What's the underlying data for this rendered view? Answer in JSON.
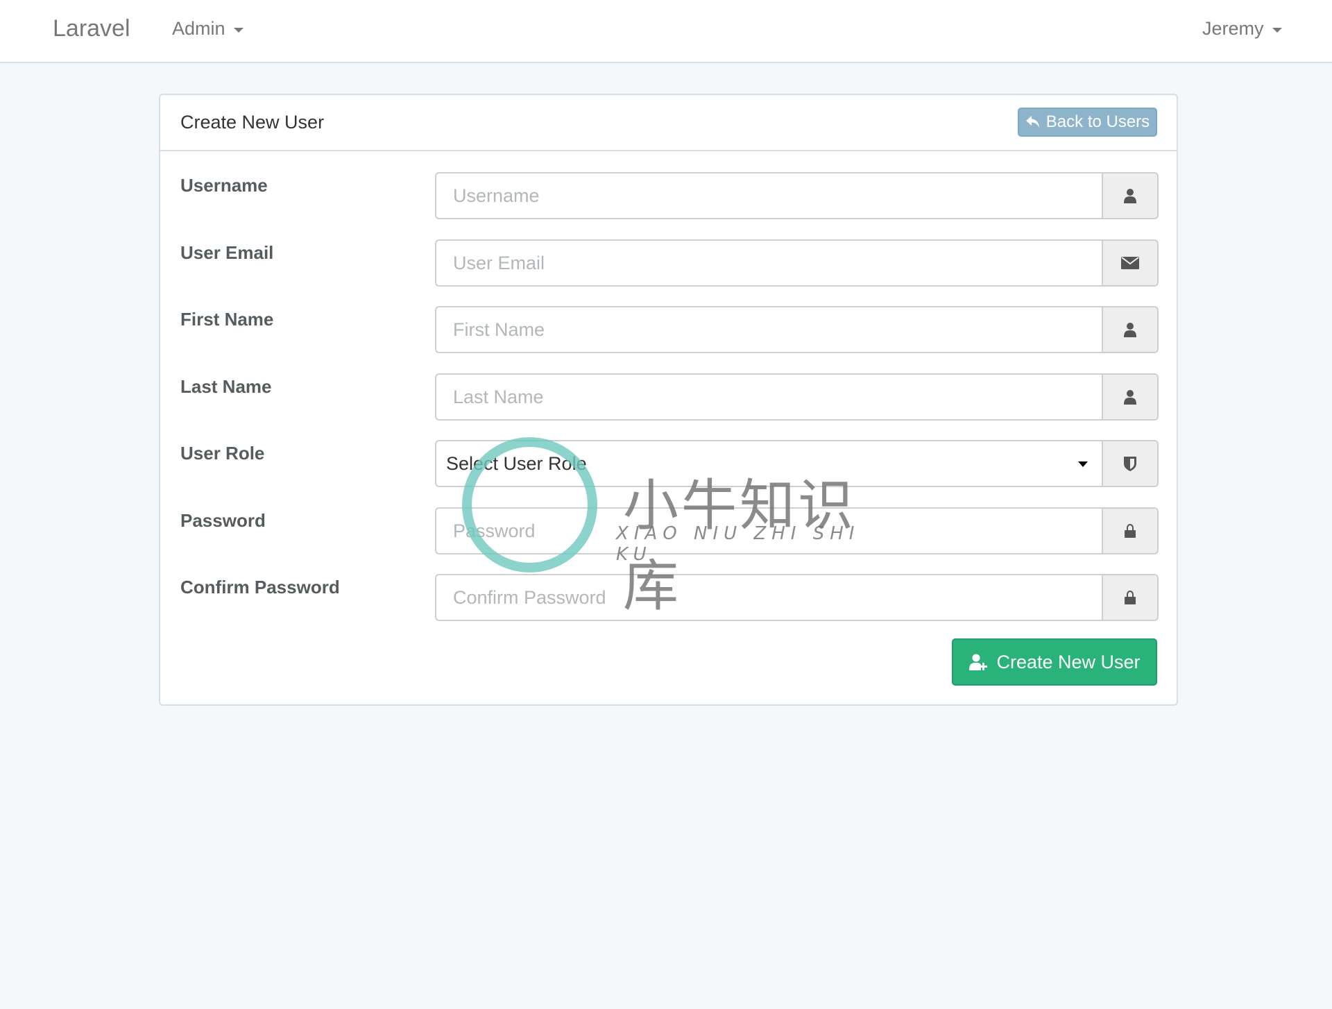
{
  "navbar": {
    "brand": "Laravel",
    "admin_menu": "Admin",
    "user_menu": "Jeremy"
  },
  "panel": {
    "title": "Create New User",
    "back_button": "Back to Users",
    "back_icon": "reply-icon"
  },
  "form": {
    "fields": [
      {
        "label": "Username",
        "placeholder": "Username",
        "value": "",
        "icon": "user-icon"
      },
      {
        "label": "User Email",
        "placeholder": "User Email",
        "value": "",
        "icon": "envelope-icon"
      },
      {
        "label": "First Name",
        "placeholder": "First Name",
        "value": "",
        "icon": "user-icon"
      },
      {
        "label": "Last Name",
        "placeholder": "Last Name",
        "value": "",
        "icon": "user-icon"
      },
      {
        "label": "User Role",
        "selected": "Select User Role",
        "icon": "shield-icon"
      },
      {
        "label": "Password",
        "placeholder": "Password",
        "value": "",
        "icon": "lock-icon"
      },
      {
        "label": "Confirm Password",
        "placeholder": "Confirm Password",
        "value": "",
        "icon": "lock-icon"
      }
    ],
    "submit_button": "Create New User",
    "submit_icon": "user-plus-icon"
  },
  "watermark": {
    "chinese": "小牛知识库",
    "pinyin": "XIAO NIU ZHI SHI KU"
  },
  "colors": {
    "page_background": "#f5f8fa",
    "success": "#2ab27b",
    "back_button": "#8eb4cb",
    "border": "#d3e0e9"
  }
}
